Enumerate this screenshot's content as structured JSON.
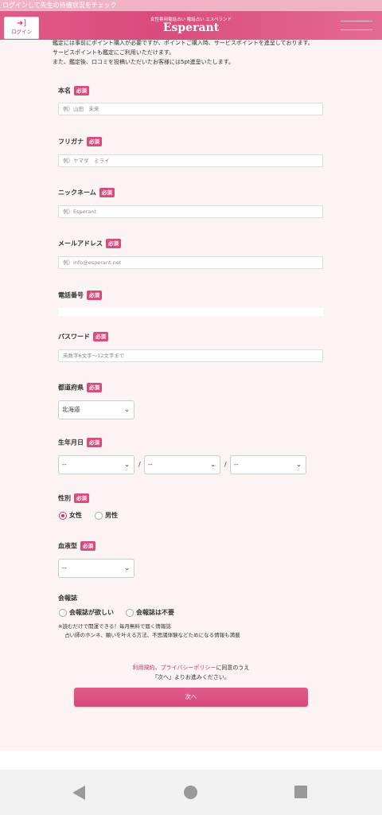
{
  "top_notice": "ログインして先生の待機状況をチェック",
  "header": {
    "login_label": "ログイン",
    "brand_sub": "女性専用電話占い 電話占い エスペランド",
    "brand": "Esperant"
  },
  "intro_lines": [
    "鑑定には事前にポイント購入が必要ですが、ポイントご購入時、サービスポイントを進呈しております。",
    "サービスポイントも鑑定にご利用いただけます。",
    "また、鑑定後、口コミを投稿いただいたお客様には5pt進呈いたします。"
  ],
  "required_badge": "必須",
  "fields": {
    "name": {
      "label": "本名",
      "placeholder": "例）山田　未来"
    },
    "kana": {
      "label": "フリガナ",
      "placeholder": "例）ヤマダ　ミライ"
    },
    "nickname": {
      "label": "ニックネーム",
      "placeholder": "例）Esperant"
    },
    "email": {
      "label": "メールアドレス",
      "placeholder": "例）info@esperant.net"
    },
    "phone": {
      "label": "電話番号"
    },
    "password": {
      "label": "パスワード",
      "placeholder": "英数字6文字〜12文字まで"
    },
    "prefecture": {
      "label": "都道府県",
      "value": "北海道"
    },
    "birthday": {
      "label": "生年月日",
      "year": "--",
      "month": "--",
      "day": "--",
      "sep": "/"
    },
    "gender": {
      "label": "性別",
      "options": [
        "女性",
        "男性"
      ],
      "selected": "女性"
    },
    "blood": {
      "label": "血液型",
      "value": "--"
    },
    "magazine": {
      "label": "会報誌",
      "options": [
        "会報誌が欲しい",
        "会報誌は不要"
      ]
    }
  },
  "magazine_note": [
    "※読むだけで開運できる！毎月無料で届く情報誌",
    "占い師のホンネ、願いを叶える方法、不思議体験などためになる情報も満載"
  ],
  "agreement": {
    "terms_link": "利用規約",
    "sep": "、",
    "privacy_link": "プライバシーポリシー",
    "suffix": "に同意のうえ",
    "line2": "「次へ」よりお進みください。"
  },
  "next_button": "次へ",
  "colors": {
    "accent": "#d94b7c",
    "background": "#fbf4f3"
  }
}
